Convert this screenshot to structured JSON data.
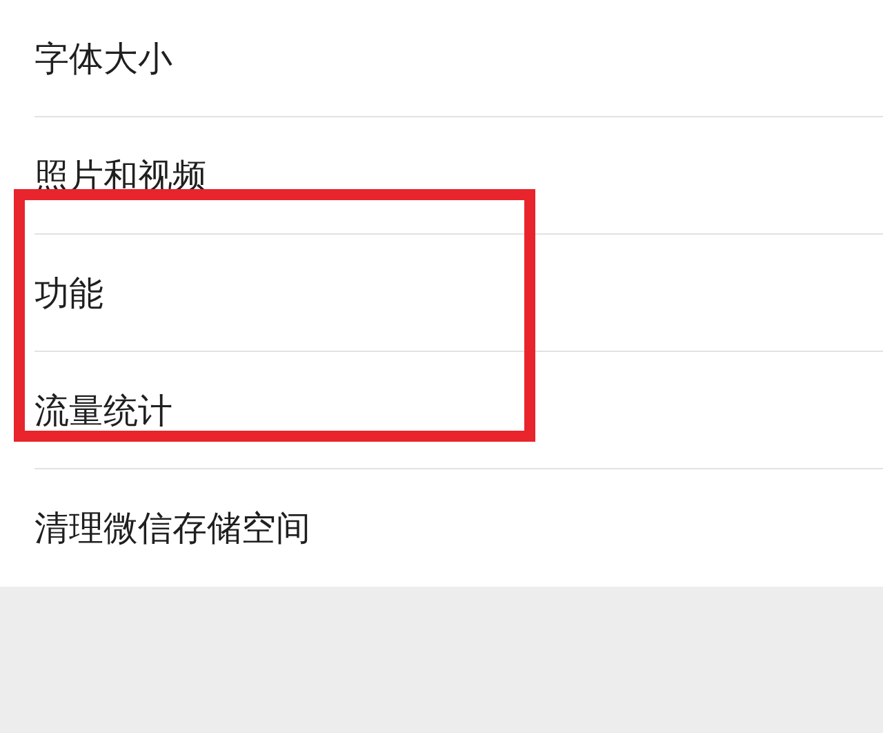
{
  "settings": {
    "items": [
      {
        "label": "字体大小"
      },
      {
        "label": "照片和视频"
      },
      {
        "label": "功能"
      },
      {
        "label": "流量统计"
      },
      {
        "label": "清理微信存储空间"
      }
    ]
  }
}
